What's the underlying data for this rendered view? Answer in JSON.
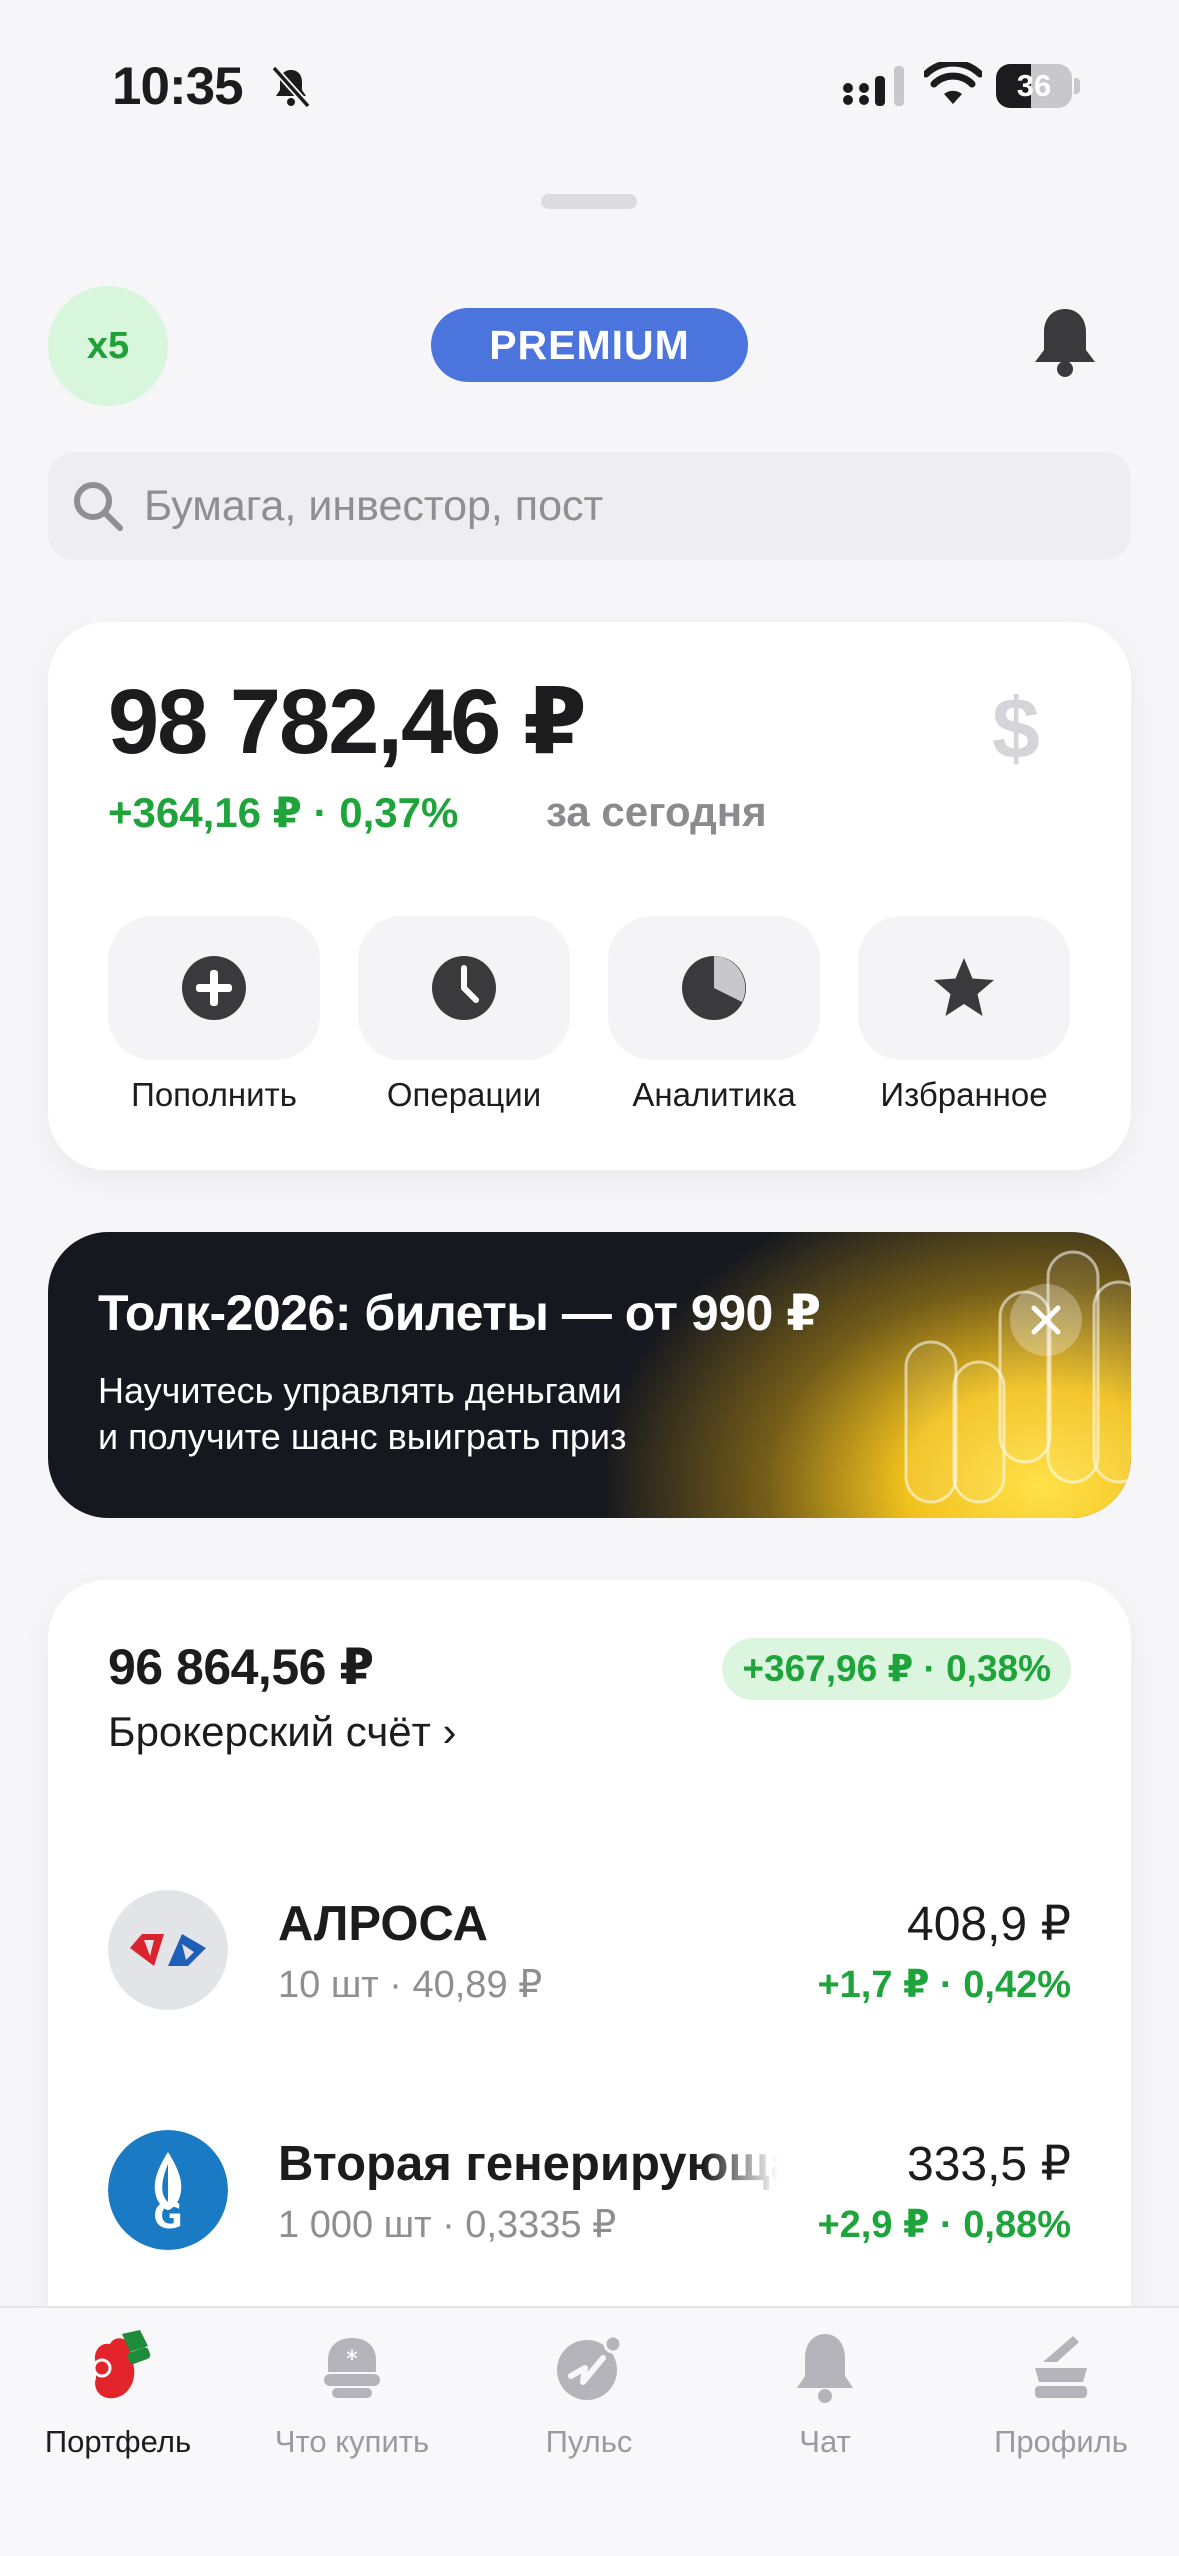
{
  "status_bar": {
    "time": "10:35",
    "battery": "36"
  },
  "header": {
    "level_badge": "x5",
    "premium_badge": "PREMIUM"
  },
  "search": {
    "placeholder": "Бумага, инвестор, пост"
  },
  "balance": {
    "amount": "98 782,46 ₽",
    "currency_symbol": "$",
    "today_change": "+364,16 ₽ · 0,37%",
    "today_label": "за сегодня",
    "actions": [
      {
        "label": "Пополнить",
        "icon": "plus-circle-icon"
      },
      {
        "label": "Операции",
        "icon": "clock-icon"
      },
      {
        "label": "Аналитика",
        "icon": "pie-chart-icon"
      },
      {
        "label": "Избранное",
        "icon": "star-icon"
      }
    ]
  },
  "promo": {
    "title": "Толк-2026: билеты — от 990 ₽",
    "subtitle_line1": "Научитесь управлять деньгами",
    "subtitle_line2": "и получите шанс выиграть приз"
  },
  "account": {
    "total": "96 864,56 ₽",
    "change": "+367,96 ₽ · 0,38%",
    "name": "Брокерский счёт ›",
    "positions": [
      {
        "name": "АЛРОСА",
        "sub": "10 шт · 40,89 ₽",
        "price": "408,9 ₽",
        "change": "+1,7 ₽ · 0,42%",
        "logo": "alrosa-logo"
      },
      {
        "name": "Вторая генерирующая",
        "sub": "1 000 шт · 0,3335 ₽",
        "price": "333,5 ₽",
        "change": "+2,9 ₽ · 0,88%",
        "logo": "gazprom-logo"
      }
    ]
  },
  "tabbar": {
    "tabs": [
      {
        "label": "Портфель",
        "icon": "mitten-icon",
        "active": true
      },
      {
        "label": "Что купить",
        "icon": "shopping-icon",
        "active": false
      },
      {
        "label": "Пульс",
        "icon": "pulse-icon",
        "active": false
      },
      {
        "label": "Чат",
        "icon": "bell-chat-icon",
        "active": false
      },
      {
        "label": "Профиль",
        "icon": "profile-icon",
        "active": false
      }
    ]
  },
  "colors": {
    "accent_green": "#1ea43a",
    "premium_blue": "#4b74dc",
    "promo_dark": "#16181f"
  }
}
